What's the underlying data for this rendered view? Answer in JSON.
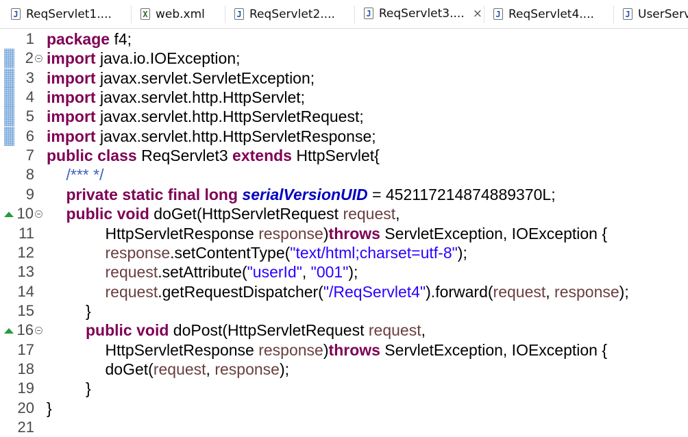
{
  "tabs": [
    {
      "label": "ReqServlet1....",
      "icon": "java-file-icon",
      "active": false
    },
    {
      "label": "web.xml",
      "icon": "xml-file-icon",
      "active": false
    },
    {
      "label": "ReqServlet2....",
      "icon": "java-file-icon",
      "active": false
    },
    {
      "label": "ReqServlet3....",
      "icon": "java-file-icon",
      "active": true,
      "close": "×"
    },
    {
      "label": "ReqServlet4....",
      "icon": "java-file-icon",
      "active": false
    },
    {
      "label": "UserServ",
      "icon": "java-file-icon",
      "active": false
    }
  ],
  "icon_glyphs": {
    "java": "J",
    "xml": "X"
  },
  "colors": {
    "keyword": "#7f0055",
    "variable": "#6a3e3e",
    "string": "#2a00ff",
    "comment": "#3f5fbf",
    "field": "#0000c0",
    "override_marker": "#2c9a3c",
    "change_bar": "#7aa8d8"
  },
  "editor": {
    "lines": [
      {
        "num": "1",
        "tokens": [
          {
            "t": "kw",
            "v": "package"
          },
          {
            "t": "p",
            "v": " f4;"
          }
        ]
      },
      {
        "num": "2",
        "fold": true,
        "change": true,
        "tokens": [
          {
            "t": "kw",
            "v": "import"
          },
          {
            "t": "p",
            "v": " java.io.IOException;"
          }
        ]
      },
      {
        "num": "3",
        "change": true,
        "tokens": [
          {
            "t": "kw",
            "v": "import"
          },
          {
            "t": "p",
            "v": " javax.servlet.ServletException;"
          }
        ]
      },
      {
        "num": "4",
        "change": true,
        "tokens": [
          {
            "t": "kw",
            "v": "import"
          },
          {
            "t": "p",
            "v": " javax.servlet.http.HttpServlet;"
          }
        ]
      },
      {
        "num": "5",
        "change": true,
        "tokens": [
          {
            "t": "kw",
            "v": "import"
          },
          {
            "t": "p",
            "v": " javax.servlet.http.HttpServletRequest;"
          }
        ]
      },
      {
        "num": "6",
        "change": true,
        "tokens": [
          {
            "t": "kw",
            "v": "import"
          },
          {
            "t": "p",
            "v": " javax.servlet.http.HttpServletResponse;"
          }
        ]
      },
      {
        "num": "7",
        "tokens": [
          {
            "t": "kw",
            "v": "public"
          },
          {
            "t": "p",
            "v": " "
          },
          {
            "t": "kw",
            "v": "class"
          },
          {
            "t": "p",
            "v": " ReqServlet3 "
          },
          {
            "t": "kw",
            "v": "extends"
          },
          {
            "t": "p",
            "v": " HttpServlet{"
          }
        ]
      },
      {
        "num": "8",
        "indent": 1,
        "tokens": [
          {
            "t": "cmt",
            "v": "/*** */"
          }
        ]
      },
      {
        "num": "9",
        "indent": 1,
        "tokens": [
          {
            "t": "kw",
            "v": "private"
          },
          {
            "t": "p",
            "v": " "
          },
          {
            "t": "kw",
            "v": "static"
          },
          {
            "t": "p",
            "v": " "
          },
          {
            "t": "kw",
            "v": "final"
          },
          {
            "t": "p",
            "v": " "
          },
          {
            "t": "kw",
            "v": "long"
          },
          {
            "t": "p",
            "v": " "
          },
          {
            "t": "field",
            "v": "serialVersionUID"
          },
          {
            "t": "p",
            "v": " = 452117214874889370L;"
          }
        ]
      },
      {
        "num": "10",
        "fold": true,
        "override": true,
        "indent": 1,
        "tokens": [
          {
            "t": "kw",
            "v": "public"
          },
          {
            "t": "p",
            "v": " "
          },
          {
            "t": "kw",
            "v": "void"
          },
          {
            "t": "p",
            "v": " doGet(HttpServletRequest "
          },
          {
            "t": "var",
            "v": "request"
          },
          {
            "t": "p",
            "v": ","
          }
        ]
      },
      {
        "num": "11",
        "indent": 3,
        "tokens": [
          {
            "t": "p",
            "v": "HttpServletResponse "
          },
          {
            "t": "var",
            "v": "response"
          },
          {
            "t": "p",
            "v": ")"
          },
          {
            "t": "kw",
            "v": "throws"
          },
          {
            "t": "p",
            "v": " ServletException, IOException {"
          }
        ]
      },
      {
        "num": "12",
        "indent": 3,
        "tokens": [
          {
            "t": "var",
            "v": "response"
          },
          {
            "t": "p",
            "v": ".setContentType("
          },
          {
            "t": "str",
            "v": "\"text/html;charset=utf-8\""
          },
          {
            "t": "p",
            "v": ");"
          }
        ]
      },
      {
        "num": "13",
        "indent": 3,
        "tokens": [
          {
            "t": "var",
            "v": "request"
          },
          {
            "t": "p",
            "v": ".setAttribute("
          },
          {
            "t": "str",
            "v": "\"userId\""
          },
          {
            "t": "p",
            "v": ", "
          },
          {
            "t": "str",
            "v": "\"001\""
          },
          {
            "t": "p",
            "v": ");"
          }
        ]
      },
      {
        "num": "14",
        "indent": 3,
        "tokens": [
          {
            "t": "var",
            "v": "request"
          },
          {
            "t": "p",
            "v": ".getRequestDispatcher("
          },
          {
            "t": "str",
            "v": "\"/ReqServlet4\""
          },
          {
            "t": "p",
            "v": ").forward("
          },
          {
            "t": "var",
            "v": "request"
          },
          {
            "t": "p",
            "v": ", "
          },
          {
            "t": "var",
            "v": "response"
          },
          {
            "t": "p",
            "v": ");"
          }
        ]
      },
      {
        "num": "15",
        "indent": 2,
        "tokens": [
          {
            "t": "p",
            "v": "}"
          }
        ]
      },
      {
        "num": "16",
        "fold": true,
        "override": true,
        "indent": 2,
        "tokens": [
          {
            "t": "kw",
            "v": "public"
          },
          {
            "t": "p",
            "v": " "
          },
          {
            "t": "kw",
            "v": "void"
          },
          {
            "t": "p",
            "v": " doPost(HttpServletRequest "
          },
          {
            "t": "var",
            "v": "request"
          },
          {
            "t": "p",
            "v": ","
          }
        ]
      },
      {
        "num": "17",
        "indent": 3,
        "tokens": [
          {
            "t": "p",
            "v": "HttpServletResponse "
          },
          {
            "t": "var",
            "v": "response"
          },
          {
            "t": "p",
            "v": ")"
          },
          {
            "t": "kw",
            "v": "throws"
          },
          {
            "t": "p",
            "v": " ServletException, IOException {"
          }
        ]
      },
      {
        "num": "18",
        "indent": 3,
        "tokens": [
          {
            "t": "p",
            "v": "doGet("
          },
          {
            "t": "var",
            "v": "request"
          },
          {
            "t": "p",
            "v": ", "
          },
          {
            "t": "var",
            "v": "response"
          },
          {
            "t": "p",
            "v": ");"
          }
        ]
      },
      {
        "num": "19",
        "indent": 2,
        "tokens": [
          {
            "t": "p",
            "v": "}"
          }
        ]
      },
      {
        "num": "20",
        "tokens": [
          {
            "t": "p",
            "v": "}"
          }
        ]
      },
      {
        "num": "21",
        "tokens": []
      }
    ]
  }
}
